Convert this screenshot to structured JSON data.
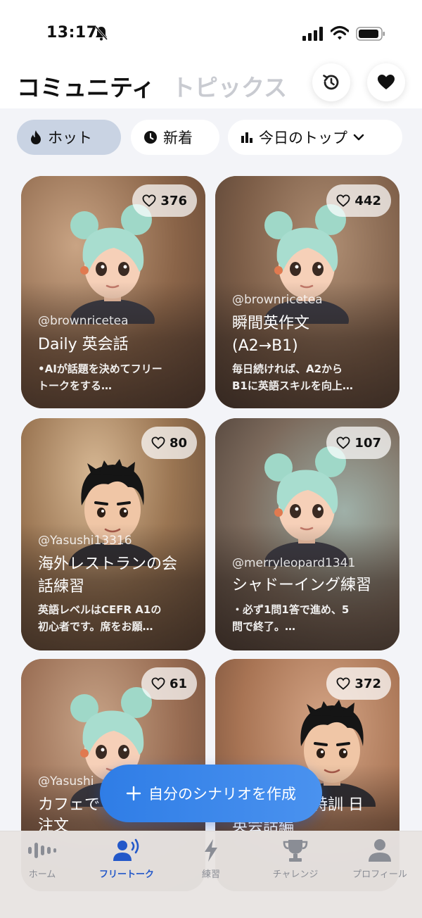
{
  "status_bar": {
    "time": "13:17"
  },
  "header": {
    "tab_community": "コミュニティ",
    "tab_topics": "トピックス"
  },
  "filters": {
    "hot": "ホット",
    "new": "新着",
    "top": "今日のトップ"
  },
  "cards": [
    {
      "likes": "376",
      "author": "@brownricetea",
      "title": "Daily 英会話",
      "title2": "",
      "desc": "•AIが話題を決めてフリー",
      "desc2": "トークをする…"
    },
    {
      "likes": "442",
      "author": "@brownricetea",
      "title": "瞬間英作文",
      "title2": "(A2→B1)",
      "desc": "毎日続ければ、A2から",
      "desc2": "B1に英語スキルを向上…"
    },
    {
      "likes": "80",
      "author": "@Yasushi13316",
      "title": "海外レストランの会",
      "title2": "話練習",
      "desc": "英語レベルはCEFR A1の",
      "desc2": "初心者です。席をお願…"
    },
    {
      "likes": "107",
      "author": "@merryleopard1341",
      "title": "シャドーイング練習",
      "title2": "",
      "desc": "・必ず1問1答で進め、5",
      "desc2": "問で終了。…"
    },
    {
      "likes": "61",
      "author": "@Yasushi",
      "title": "カフェで",
      "title2": "注文",
      "desc": "",
      "desc2": ""
    },
    {
      "likes": "372",
      "author": "",
      "title": "特訓 日",
      "title2": "英会話編",
      "desc": "",
      "desc2": ""
    }
  ],
  "fab_label": "自分のシナリオを作成",
  "nav": {
    "home": "ホーム",
    "free_talk": "フリートーク",
    "practice": "練習",
    "challenge": "チャレンジ",
    "profile": "プロフィール"
  },
  "colors": {
    "accent": "#2f7de6",
    "active_nav": "#2358c9",
    "chip_selected": "#c9d3e3"
  }
}
